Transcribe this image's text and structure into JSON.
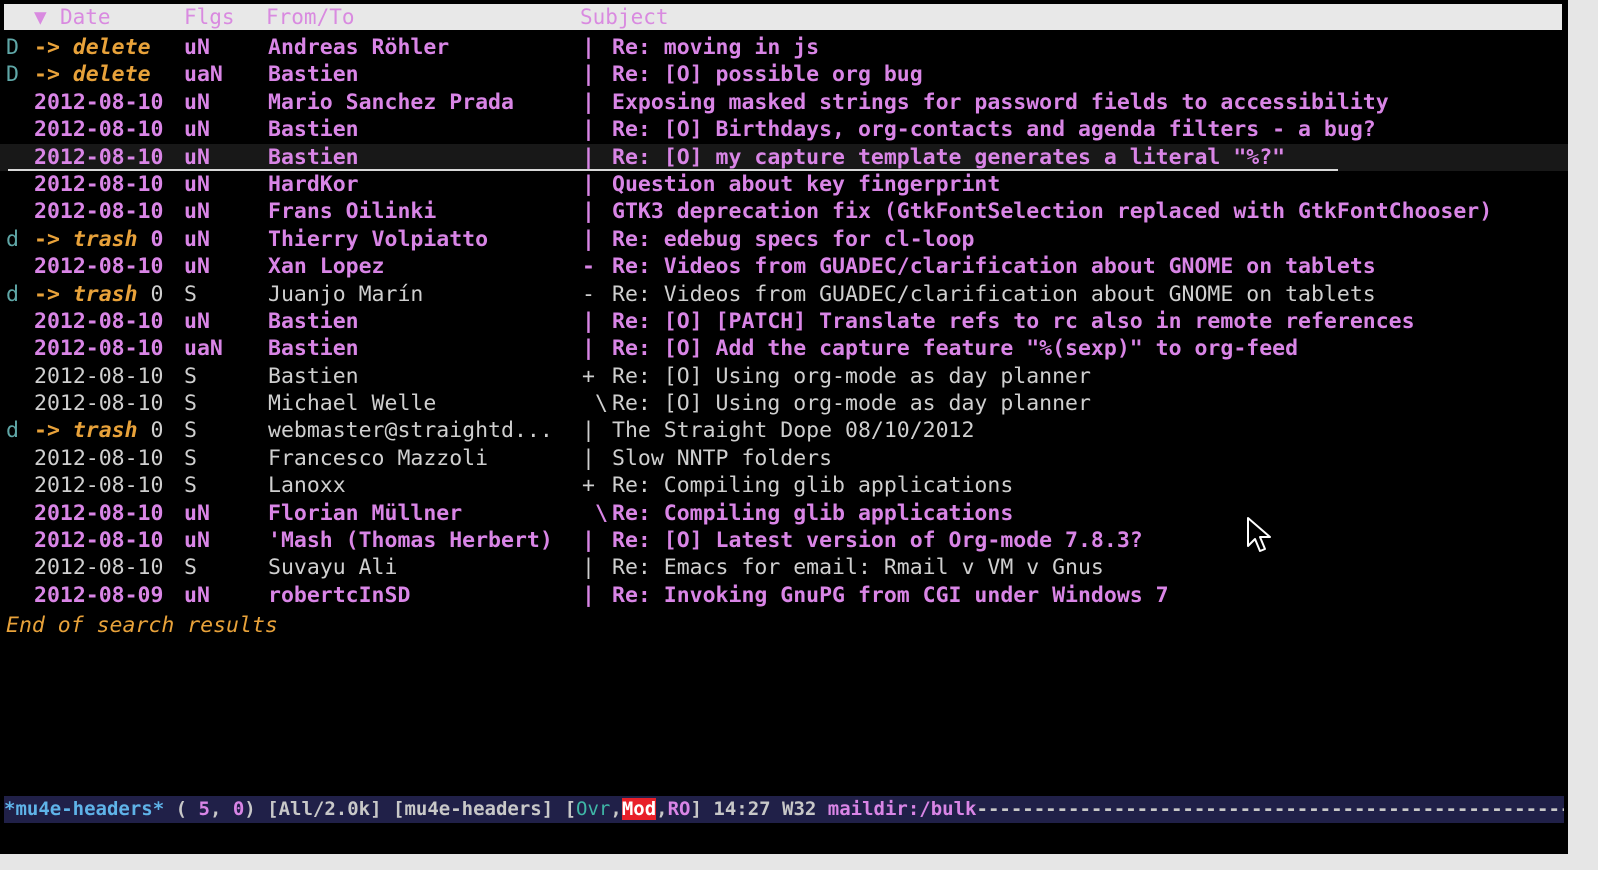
{
  "header": {
    "sort_indicator": "▼",
    "date": "Date",
    "flags": "Flgs",
    "from": "From/To",
    "subject": "Subject"
  },
  "rows": [
    {
      "mark": "D",
      "action": "delete",
      "flags": "uN",
      "from": "Andreas Röhler",
      "tree": "|",
      "subject": "Re: moving in js",
      "unread": true
    },
    {
      "mark": "D",
      "action": "delete",
      "flags": "uaN",
      "from": "Bastien",
      "tree": "|",
      "subject": "Re: [O] possible org bug",
      "unread": true
    },
    {
      "date": "2012-08-10",
      "flags": "uN",
      "from": "Mario Sanchez Prada",
      "tree": "|",
      "subject": "Exposing masked strings for password fields to accessibility",
      "unread": true
    },
    {
      "date": "2012-08-10",
      "flags": "uN",
      "from": "Bastien",
      "tree": "|",
      "subject": "Re: [O] Birthdays, org-contacts and agenda filters - a bug?",
      "unread": true
    },
    {
      "date": "2012-08-10",
      "flags": "uN",
      "from": "Bastien",
      "tree": "|",
      "subject": "Re: [O] my capture template generates a literal \"%?\"",
      "unread": true,
      "current": true
    },
    {
      "date": "2012-08-10",
      "flags": "uN",
      "from": "HardKor",
      "tree": "|",
      "subject": "Question about key fingerprint",
      "unread": true
    },
    {
      "date": "2012-08-10",
      "flags": "uN",
      "from": "Frans Oilinki",
      "tree": "|",
      "subject": "GTK3 deprecation fix (GtkFontSelection replaced with GtkFontChooser)",
      "unread": true
    },
    {
      "mark": "d",
      "action": "trash",
      "count": "0",
      "flags": "uN",
      "from": "Thierry Volpiatto",
      "tree": "|",
      "subject": "Re: edebug specs for cl-loop",
      "unread": true
    },
    {
      "date": "2012-08-10",
      "flags": "uN",
      "from": "Xan Lopez",
      "tree": "-",
      "subject": "Re: Videos from GUADEC/clarification about GNOME on tablets",
      "unread": true
    },
    {
      "mark": "d",
      "action": "trash",
      "count": "0",
      "flags": "S",
      "from": "Juanjo Marín",
      "tree": "-",
      "subject": "Re: Videos from GUADEC/clarification about GNOME on tablets",
      "unread": false
    },
    {
      "date": "2012-08-10",
      "flags": "uN",
      "from": "Bastien",
      "tree": "|",
      "subject": "Re: [O] [PATCH] Translate refs to rc also in remote references",
      "unread": true
    },
    {
      "date": "2012-08-10",
      "flags": "uaN",
      "from": "Bastien",
      "tree": "|",
      "subject": "Re: [O] Add the capture feature \"%(sexp)\" to org-feed",
      "unread": true
    },
    {
      "date": "2012-08-10",
      "flags": "S",
      "from": "Bastien",
      "tree": "+",
      "subject": "Re: [O] Using org-mode as day planner",
      "unread": false
    },
    {
      "date": "2012-08-10",
      "flags": "S",
      "from": "Michael Welle",
      "tree": " \\",
      "subject": "Re: [O] Using org-mode as day planner",
      "unread": false
    },
    {
      "mark": "d",
      "action": "trash",
      "count": "0",
      "flags": "S",
      "from": "webmaster@straightd...",
      "tree": "|",
      "subject": "The Straight Dope 08/10/2012",
      "unread": false
    },
    {
      "date": "2012-08-10",
      "flags": "S",
      "from": "Francesco Mazzoli",
      "tree": "|",
      "subject": "Slow NNTP folders",
      "unread": false
    },
    {
      "date": "2012-08-10",
      "flags": "S",
      "from": "Lanoxx",
      "tree": "+",
      "subject": "Re: Compiling glib applications",
      "unread": false
    },
    {
      "date": "2012-08-10",
      "flags": "uN",
      "from": "Florian Müllner",
      "tree": " \\",
      "subject": "Re: Compiling glib applications",
      "unread": true
    },
    {
      "date": "2012-08-10",
      "flags": "uN",
      "from": "'Mash (Thomas Herbert)",
      "tree": "|",
      "subject": "Re: [O] Latest version of Org-mode 7.8.3?",
      "unread": true
    },
    {
      "date": "2012-08-10",
      "flags": "S",
      "from": "Suvayu Ali",
      "tree": "|",
      "subject": "Re: Emacs for email: Rmail v VM v Gnus",
      "unread": false
    },
    {
      "date": "2012-08-09",
      "flags": "uN",
      "from": "robertcInSD",
      "tree": "|",
      "subject": "Re: Invoking GnuPG from CGI under Windows 7",
      "unread": true
    }
  ],
  "end_message": "End of search results",
  "modeline": {
    "buffer": "*mu4e-headers*",
    "pos_open": " ( ",
    "line": "5",
    "comma": ", ",
    "col": "0",
    "pos_close": ") ",
    "size": "[All/2.0k]",
    "mode": " [mu4e-headers] ",
    "br_open": "[",
    "ovr": "Ovr",
    "sep1": ",",
    "mod": "Mod",
    "sep2": ",",
    "ro": "RO",
    "br_close": "] ",
    "time": "14:27 W32 ",
    "maildir": "maildir:/bulk",
    "dashes": "------------------------------------------------------------------------------------"
  },
  "colors": {
    "unread": "#d985e6",
    "seen": "#cfcfcf",
    "mark": "#5fa7a7",
    "action": "#e8a23a",
    "modeline_bg": "#202048",
    "mod_badge": "#e8202a"
  }
}
